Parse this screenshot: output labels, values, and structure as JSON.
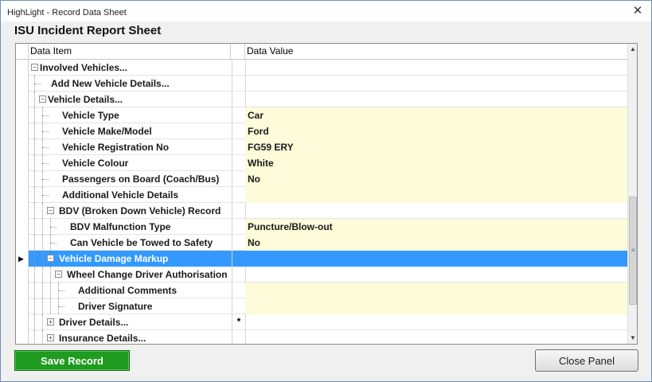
{
  "window": {
    "title": "HighLight - Record Data Sheet",
    "close_glyph": "✕"
  },
  "sheet": {
    "heading": "ISU Incident Report Sheet"
  },
  "grid": {
    "columns": {
      "item": "Data Item",
      "value": "Data Value"
    },
    "rows": [
      {
        "label": "Involved Vehicles...",
        "value": "",
        "depth": 0,
        "expander": "minus",
        "yellow": false
      },
      {
        "label": "Add New Vehicle Details...",
        "value": "",
        "depth": 1,
        "expander": "",
        "yellow": false
      },
      {
        "label": "Vehicle Details...",
        "value": "",
        "depth": 1,
        "expander": "minus",
        "yellow": false
      },
      {
        "label": "Vehicle Type",
        "value": "Car",
        "depth": 2,
        "expander": "",
        "yellow": true
      },
      {
        "label": "Vehicle Make/Model",
        "value": "Ford",
        "depth": 2,
        "expander": "",
        "yellow": true
      },
      {
        "label": "Vehicle Registration No",
        "value": "FG59 ERY",
        "depth": 2,
        "expander": "",
        "yellow": true
      },
      {
        "label": "Vehicle Colour",
        "value": "White",
        "depth": 2,
        "expander": "",
        "yellow": true
      },
      {
        "label": "Passengers on Board (Coach/Bus)",
        "value": "No",
        "depth": 2,
        "expander": "",
        "yellow": true
      },
      {
        "label": "Additional Vehicle Details",
        "value": "",
        "depth": 2,
        "expander": "",
        "yellow": true
      },
      {
        "label": "BDV (Broken Down Vehicle) Record",
        "value": "",
        "depth": 2,
        "expander": "minus",
        "yellow": false
      },
      {
        "label": "BDV Malfunction Type",
        "value": "Puncture/Blow-out",
        "depth": 3,
        "expander": "",
        "yellow": true
      },
      {
        "label": "Can Vehicle be Towed to Safety",
        "value": "No",
        "depth": 3,
        "expander": "",
        "yellow": true
      },
      {
        "label": "Vehicle Damage Markup",
        "value": "",
        "depth": 2,
        "expander": "minus",
        "yellow": false,
        "selected": true
      },
      {
        "label": "Wheel Change Driver Authorisation",
        "value": "",
        "depth": 3,
        "expander": "minus",
        "yellow": false
      },
      {
        "label": "Additional Comments",
        "value": "",
        "depth": 4,
        "expander": "",
        "yellow": true
      },
      {
        "label": "Driver Signature",
        "value": "",
        "depth": 4,
        "expander": "",
        "yellow": true
      },
      {
        "label": "Driver Details...",
        "value": "",
        "depth": 2,
        "expander": "plus",
        "yellow": false,
        "marker": "*"
      },
      {
        "label": "Insurance Details...",
        "value": "",
        "depth": 2,
        "expander": "plus",
        "yellow": false
      }
    ],
    "current_row_indicator": "▶"
  },
  "buttons": {
    "save": "Save Record",
    "close": "Close Panel"
  },
  "colors": {
    "selection": "#3399ff",
    "value_fill": "#fdfbd9",
    "save_green": "#1f9b1f"
  },
  "icons": {
    "expand": "plus-box-icon",
    "collapse": "minus-box-icon",
    "scroll_up": "chevron-up-icon",
    "scroll_down": "chevron-down-icon"
  }
}
